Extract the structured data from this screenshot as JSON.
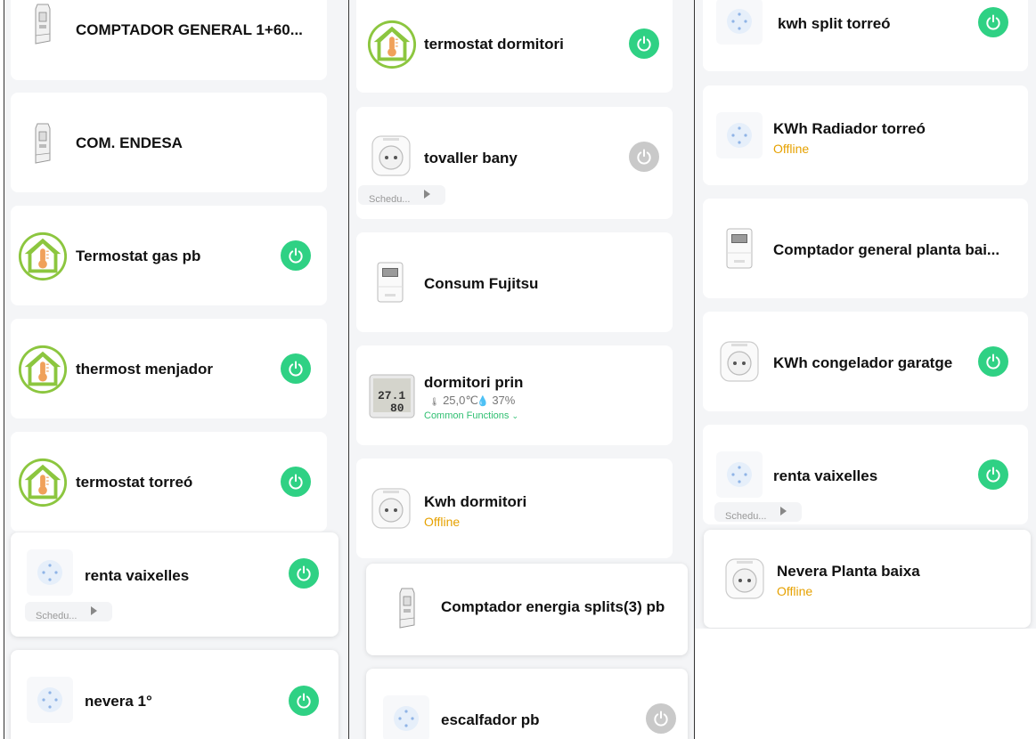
{
  "colors": {
    "accent_on": "#2fd184",
    "power_off": "#c9c9c9",
    "offline": "#e6a100",
    "thermo_green": "#8cc63f",
    "link_green": "#2fbf71"
  },
  "column1": {
    "devices": [
      {
        "name": "COMPTADOR GENERAL 1+60...",
        "icon": "din-meter-icon"
      },
      {
        "name": "COM. ENDESA",
        "icon": "din-meter-icon"
      },
      {
        "name": "Termostat gas pb",
        "icon": "thermostat-icon",
        "power": "on"
      },
      {
        "name": "thermost menjador",
        "icon": "thermostat-icon",
        "power": "on"
      },
      {
        "name": "termostat torreó",
        "icon": "thermostat-icon",
        "power": "on"
      },
      {
        "name": "renta vaixelles",
        "icon": "smart-plug-icon",
        "power": "on",
        "schedule": "Schedu..."
      },
      {
        "name": "nevera 1°",
        "icon": "smart-plug-icon",
        "power": "on"
      }
    ]
  },
  "column2": {
    "devices": [
      {
        "name": "termostat dormitori",
        "icon": "thermostat-icon",
        "power": "on"
      },
      {
        "name": "tovaller bany",
        "icon": "eu-socket-icon",
        "power": "off",
        "schedule": "Schedu..."
      },
      {
        "name": "Consum Fujitsu",
        "icon": "energy-meter-icon"
      },
      {
        "name": "dormitori prin",
        "icon": "temp-humidity-sensor-icon",
        "temperature": "25,0℃",
        "humidity": "37%",
        "common_functions": "Common Functions",
        "sensor_display": {
          "line1": "27.1",
          "line2": "80"
        }
      },
      {
        "name": "Kwh dormitori",
        "icon": "eu-socket-icon",
        "status": "Offline"
      },
      {
        "name": "Comptador energia splits(3) pb",
        "icon": "din-meter-icon"
      },
      {
        "name": "escalfador pb",
        "icon": "smart-plug-icon",
        "power": "off"
      }
    ]
  },
  "column3": {
    "devices": [
      {
        "name": "kwh split torreó",
        "icon": "smart-plug-icon",
        "power": "on"
      },
      {
        "name": "KWh Radiador torreó",
        "icon": "smart-plug-icon",
        "status": "Offline"
      },
      {
        "name": "Comptador general planta bai...",
        "icon": "energy-meter-icon"
      },
      {
        "name": "KWh congelador garatge",
        "icon": "eu-socket-icon",
        "power": "on"
      },
      {
        "name": "renta vaixelles",
        "icon": "smart-plug-icon",
        "power": "on",
        "schedule": "Schedu..."
      },
      {
        "name": "Nevera Planta baixa",
        "icon": "eu-socket-icon",
        "status": "Offline"
      }
    ]
  }
}
